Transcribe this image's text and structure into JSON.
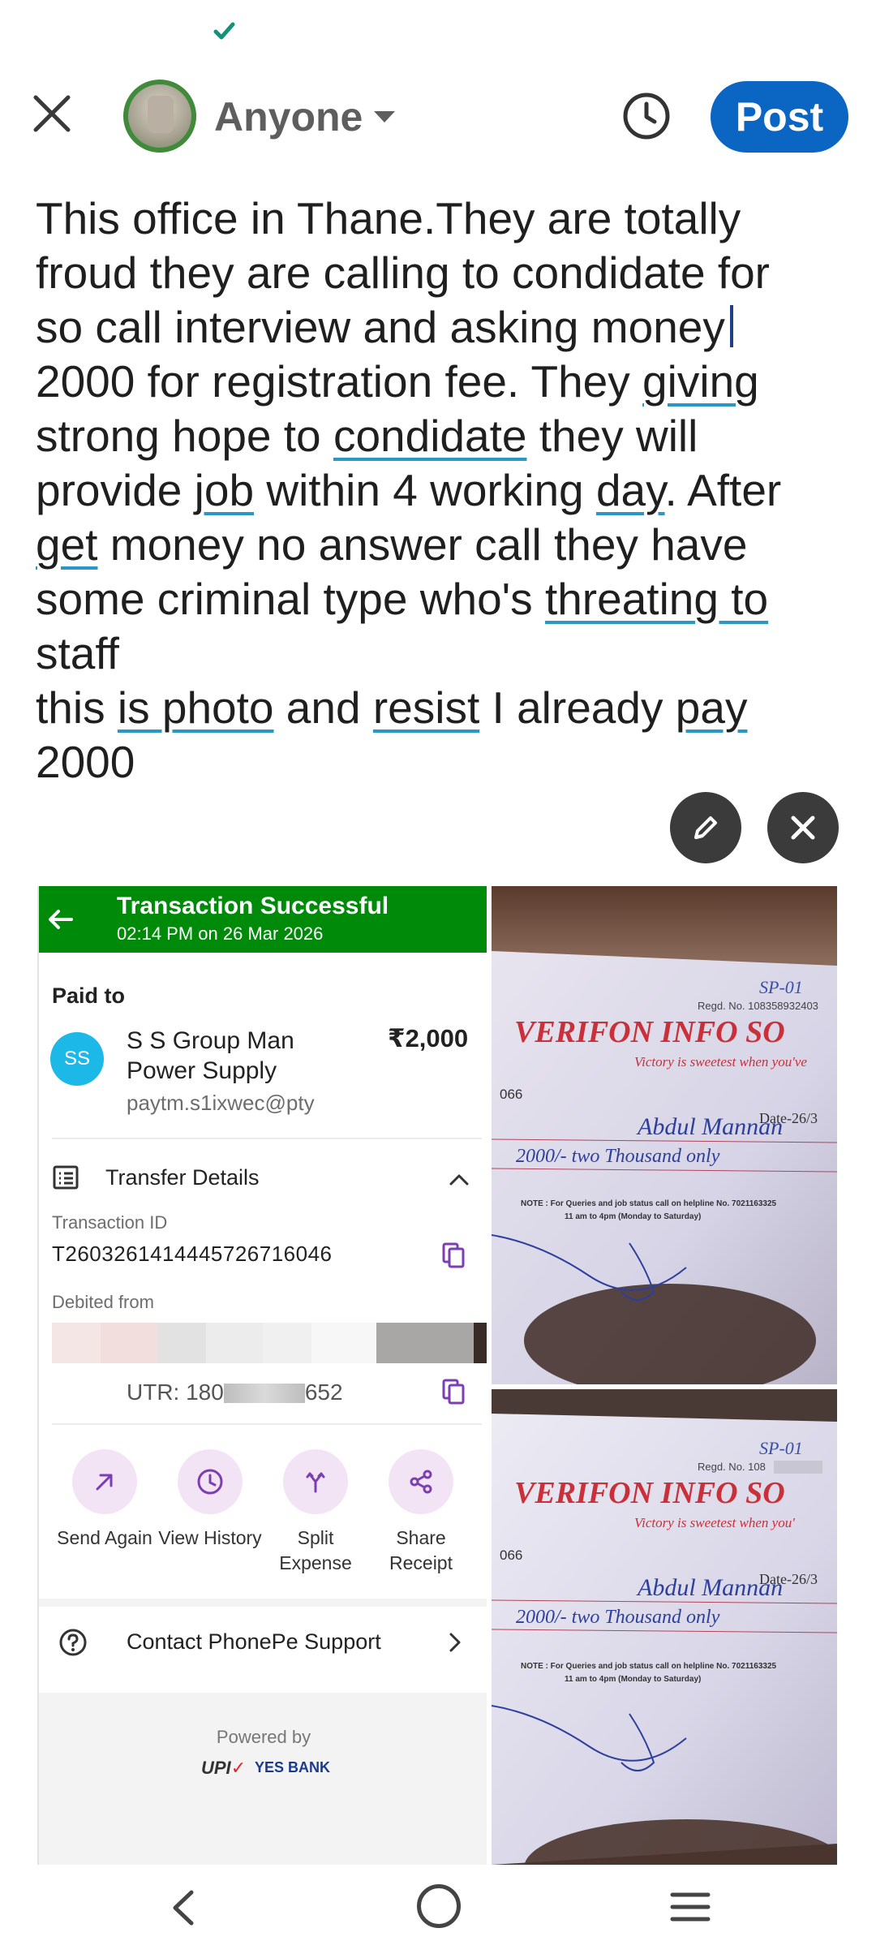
{
  "status": {
    "icon": "check-icon"
  },
  "topbar": {
    "close_icon": "close-icon",
    "avatar_icon": "avatar",
    "audience_label": "Anyone",
    "schedule_icon": "clock-icon",
    "post_label": "Post",
    "accent": "#0a66c2"
  },
  "post": {
    "lines": [
      "This office in Thane.They are totally",
      "froud they are calling to condidate for",
      "so call interview and asking money",
      "2000 for registration fee. They giving",
      "strong hope to condidate they will",
      "provide job within 4 working day. After",
      "get money no answer call they have",
      "some criminal type who's threating to",
      "staff",
      "this is photo and resist I already pay",
      "2000"
    ]
  },
  "media": {
    "edit_icon": "pencil-icon",
    "remove_icon": "close-icon"
  },
  "receipt": {
    "header_title": "Transaction Successful",
    "header_time": "02:14 PM on 26 Mar 2026",
    "paid_to_label": "Paid to",
    "payee_initials": "SS",
    "payee_name": "S S Group Man Power Supply",
    "payee_vpa": "paytm.s1ixwec@pty",
    "amount": "₹2,000",
    "transfer_details_label": "Transfer Details",
    "transaction_id_label": "Transaction ID",
    "transaction_id": "T2603261414445726716046",
    "debited_from_label": "Debited from",
    "utr": "UTR: 180",
    "utr_suffix": "652",
    "actions": [
      {
        "label": "Send Again",
        "icon": "arrow-up-right-icon"
      },
      {
        "label": "View History",
        "icon": "clock-icon"
      },
      {
        "label": "Split Expense",
        "icon": "split-icon"
      },
      {
        "label": "Share Receipt",
        "icon": "share-icon"
      }
    ],
    "support_label": "Contact PhonePe Support",
    "powered_by": "Powered by",
    "upi_logo": "UPI",
    "bank_logo": "YES BANK",
    "header_color": "#008a09"
  },
  "photos": [
    {
      "company": "VERIFON INFO SO",
      "tagline": "Victory is sweetest when you've",
      "serial": "066",
      "code": "SP-01",
      "regd": "Regd. No. 108358932403",
      "received_from": "Abdul Mannan",
      "amount_words": "2000/- two Thousand only",
      "date": "Date-26/3",
      "note": "NOTE : For Queries and job status call on helpline No. 7021163325",
      "hours": "11 am to 4pm (Monday to Saturday)"
    },
    {
      "company": "VERIFON INFO SO",
      "tagline": "Victory is sweetest when you'",
      "serial": "066",
      "code": "SP-01",
      "regd": "Regd. No. 108",
      "received_from": "Abdul Mannan",
      "amount_words": "2000/- two Thousand only",
      "date": "Date-26/3",
      "note": "NOTE : For Queries and job status call on helpline No. 7021163325",
      "hours": "11 am to 4pm (Monday to Saturday)"
    }
  ],
  "navbar": {
    "back_icon": "back-icon",
    "home_icon": "home-icon",
    "menu_icon": "menu-icon"
  }
}
